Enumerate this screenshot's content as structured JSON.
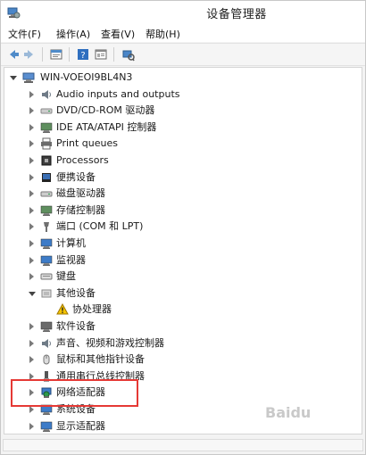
{
  "window": {
    "title": "设备管理器"
  },
  "menu": [
    {
      "name": "menu-file",
      "label": "文件(F)"
    },
    {
      "name": "menu-action",
      "label": "操作(A)"
    },
    {
      "name": "menu-view",
      "label": "查看(V)"
    },
    {
      "name": "menu-help",
      "label": "帮助(H)"
    }
  ],
  "toolbar": {
    "icons": [
      "back-icon",
      "forward-icon",
      "properties-icon",
      "help-icon",
      "console-icon",
      "scan-hardware-icon"
    ]
  },
  "tree": {
    "root": "WIN-VOEOI9BL4N3",
    "items": [
      {
        "label": "Audio inputs and outputs",
        "icon": "speaker-icon",
        "state": "collapsed",
        "level": 1
      },
      {
        "label": "DVD/CD-ROM 驱动器",
        "icon": "optical-drive-icon",
        "state": "collapsed",
        "level": 1
      },
      {
        "label": "IDE ATA/ATAPI 控制器",
        "icon": "ide-controller-icon",
        "state": "collapsed",
        "level": 1
      },
      {
        "label": "Print queues",
        "icon": "printer-icon",
        "state": "collapsed",
        "level": 1
      },
      {
        "label": "Processors",
        "icon": "processor-icon",
        "state": "collapsed",
        "level": 1
      },
      {
        "label": "便携设备",
        "icon": "portable-device-icon",
        "state": "collapsed",
        "level": 1
      },
      {
        "label": "磁盘驱动器",
        "icon": "disk-drive-icon",
        "state": "collapsed",
        "level": 1
      },
      {
        "label": "存储控制器",
        "icon": "storage-controller-icon",
        "state": "collapsed",
        "level": 1
      },
      {
        "label": "端口 (COM 和 LPT)",
        "icon": "port-icon",
        "state": "collapsed",
        "level": 1
      },
      {
        "label": "计算机",
        "icon": "computer-icon",
        "state": "collapsed",
        "level": 1
      },
      {
        "label": "监视器",
        "icon": "monitor-icon",
        "state": "collapsed",
        "level": 1
      },
      {
        "label": "键盘",
        "icon": "keyboard-icon",
        "state": "collapsed",
        "level": 1
      },
      {
        "label": "其他设备",
        "icon": "other-devices-icon",
        "state": "expanded",
        "level": 1
      },
      {
        "label": "协处理器",
        "icon": "warning-device-icon",
        "state": "none",
        "level": 2
      },
      {
        "label": "软件设备",
        "icon": "software-device-icon",
        "state": "collapsed",
        "level": 1
      },
      {
        "label": "声音、视频和游戏控制器",
        "icon": "sound-video-icon",
        "state": "collapsed",
        "level": 1
      },
      {
        "label": "鼠标和其他指针设备",
        "icon": "mouse-icon",
        "state": "collapsed",
        "level": 1
      },
      {
        "label": "通用串行总线控制器",
        "icon": "usb-icon",
        "state": "collapsed",
        "level": 1
      },
      {
        "label": "网络适配器",
        "icon": "network-adapter-icon",
        "state": "collapsed",
        "level": 1
      },
      {
        "label": "系统设备",
        "icon": "system-device-icon",
        "state": "collapsed",
        "level": 1
      },
      {
        "label": "显示适配器",
        "icon": "display-adapter-icon",
        "state": "collapsed",
        "level": 1
      }
    ]
  },
  "watermark": "Baidu"
}
